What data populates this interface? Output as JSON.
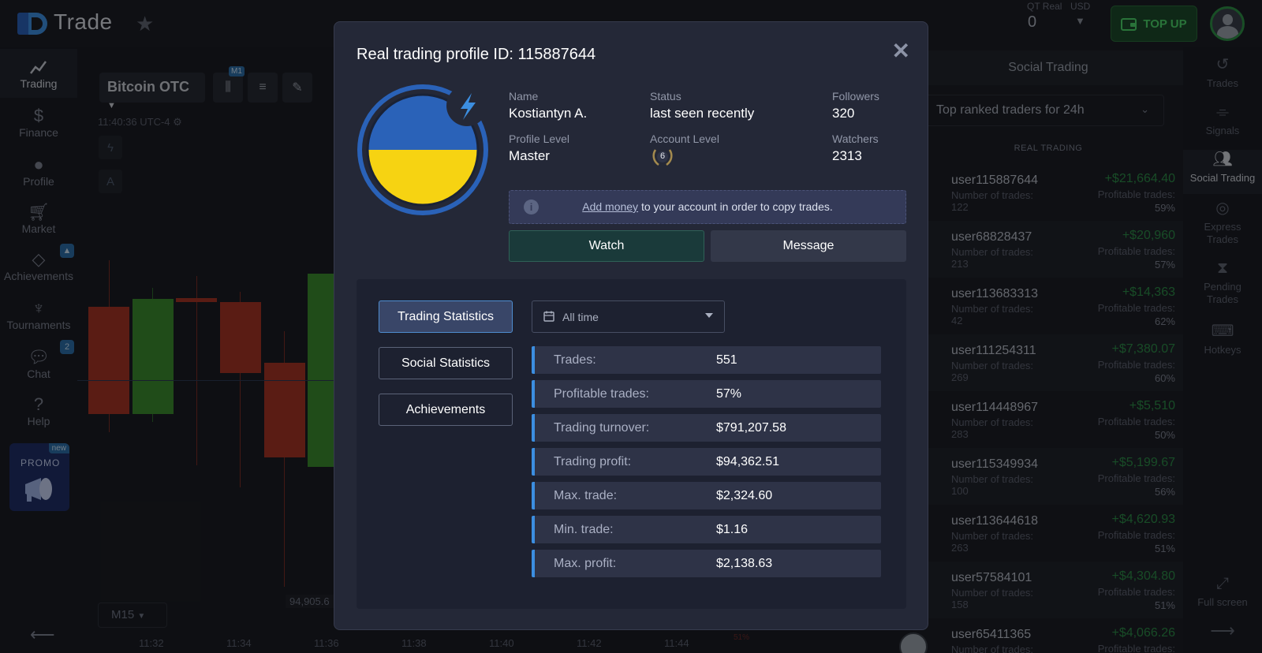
{
  "colors": {
    "accent": "#3c8ee0",
    "profit_green": "#2c8a47",
    "loss_red": "#c13d2c",
    "topup_green": "#4bd169",
    "flag_blue": "#2a62b8",
    "flag_yellow": "#f6d312"
  },
  "header": {
    "logo_text": "Trade",
    "account_type": "QT Real",
    "currency": "USD",
    "balance": "0",
    "topup_label": "TOP UP"
  },
  "leftnav": {
    "items": [
      {
        "label": "Trading",
        "icon": "chart-line-icon"
      },
      {
        "label": "Finance",
        "icon": "dollar-icon"
      },
      {
        "label": "Profile",
        "icon": "user-icon"
      },
      {
        "label": "Market",
        "icon": "cart-icon"
      },
      {
        "label": "Achievements",
        "icon": "diamond-icon"
      },
      {
        "label": "Tournaments",
        "icon": "trophy-icon"
      },
      {
        "label": "Chat",
        "icon": "chat-icon"
      },
      {
        "label": "Help",
        "icon": "help-icon"
      }
    ],
    "chat_badge": "2",
    "promo_label": "PROMO",
    "promo_new": "new"
  },
  "chart": {
    "asset": "Bitcoin OTC",
    "interval_badge": "M1",
    "time": "11:40:36 UTC-4",
    "timeframe": "M15",
    "price_label": "94,905.6",
    "percent_label": "51%",
    "x_ticks": [
      "11:32",
      "11:34",
      "11:36",
      "11:38",
      "11:40",
      "11:42",
      "11:44"
    ]
  },
  "social": {
    "title": "Social Trading",
    "filter": "Top ranked traders for 24h",
    "section": "REAL TRADING",
    "trades_label": "Number of trades:",
    "profitable_label": "Profitable trades:",
    "traders": [
      {
        "name": "user115887644",
        "trades": "122",
        "amount": "+$21,664.40",
        "profitable": "59%"
      },
      {
        "name": "user68828437",
        "trades": "213",
        "amount": "+$20,960",
        "profitable": "57%"
      },
      {
        "name": "user113683313",
        "trades": "42",
        "amount": "+$14,363",
        "profitable": "62%"
      },
      {
        "name": "user111254311",
        "trades": "269",
        "amount": "+$7,380.07",
        "profitable": "60%"
      },
      {
        "name": "user114448967",
        "trades": "283",
        "amount": "+$5,510",
        "profitable": "50%"
      },
      {
        "name": "user115349934",
        "trades": "100",
        "amount": "+$5,199.67",
        "profitable": "56%"
      },
      {
        "name": "user113644618",
        "trades": "263",
        "amount": "+$4,620.93",
        "profitable": "51%"
      },
      {
        "name": "user57584101",
        "trades": "158",
        "amount": "+$4,304.80",
        "profitable": "51%"
      },
      {
        "name": "user65411365",
        "trades": "",
        "amount": "+$4,066.26",
        "profitable": ""
      }
    ]
  },
  "rightnav": {
    "items": [
      {
        "label": "Trades",
        "icon": "history-icon"
      },
      {
        "label": "Signals",
        "icon": "signal-icon"
      },
      {
        "label": "Social Trading",
        "icon": "people-icon"
      },
      {
        "label": "Express Trades",
        "icon": "target-icon"
      },
      {
        "label": "Pending Trades",
        "icon": "hourglass-icon"
      },
      {
        "label": "Hotkeys",
        "icon": "keyboard-icon"
      },
      {
        "label": "Full screen",
        "icon": "fullscreen-icon"
      }
    ]
  },
  "modal": {
    "title": "Real trading profile ID: 115887644",
    "name_label": "Name",
    "name": "Kostiantyn A.",
    "status_label": "Status",
    "status": "last seen recently",
    "followers_label": "Followers",
    "followers": "320",
    "profile_level_label": "Profile Level",
    "profile_level": "Master",
    "account_level_label": "Account Level",
    "account_level": "6",
    "watchers_label": "Watchers",
    "watchers": "2313",
    "notice_link": "Add money",
    "notice_text": " to your account in order to copy trades.",
    "watch_label": "Watch",
    "message_label": "Message",
    "tabs": [
      "Trading Statistics",
      "Social Statistics",
      "Achievements"
    ],
    "range": "All time",
    "stats": [
      {
        "label": "Trades:",
        "value": "551"
      },
      {
        "label": "Profitable trades:",
        "value": "57%"
      },
      {
        "label": "Trading turnover:",
        "value": "$791,207.58"
      },
      {
        "label": "Trading profit:",
        "value": "$94,362.51"
      },
      {
        "label": "Max. trade:",
        "value": "$2,324.60"
      },
      {
        "label": "Min. trade:",
        "value": "$1.16"
      },
      {
        "label": "Max. profit:",
        "value": "$2,138.63"
      }
    ]
  }
}
